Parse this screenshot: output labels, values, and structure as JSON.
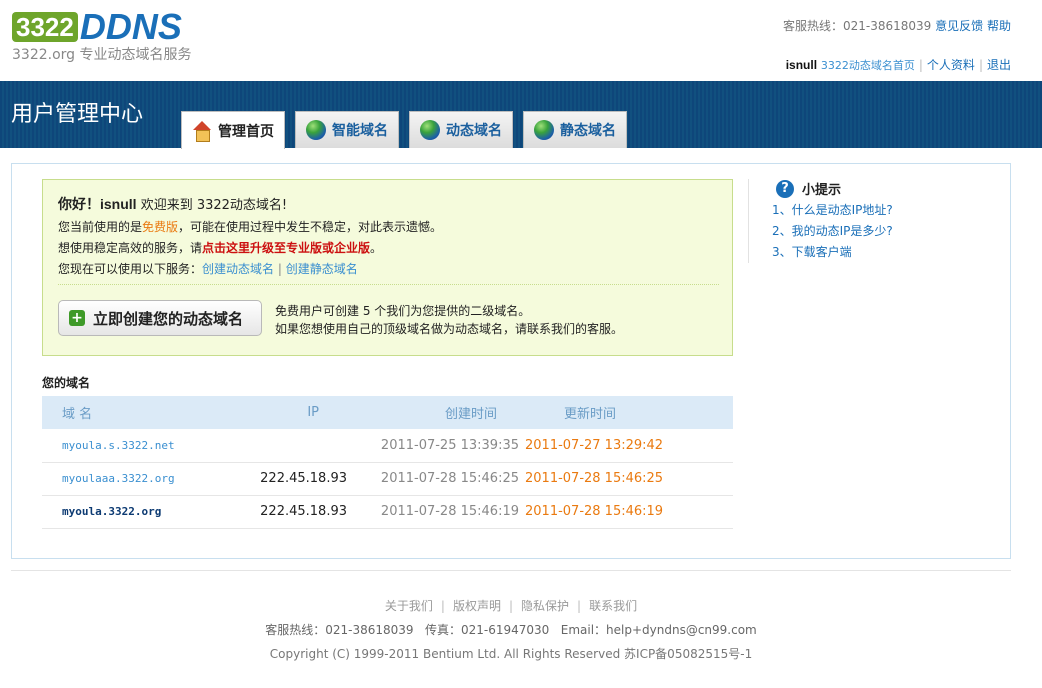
{
  "logo": {
    "num": "3322",
    "ddns": "DDNS",
    "subtitle": "3322.org 专业动态域名服务"
  },
  "top": {
    "hotline": "客服热线：021-38618039",
    "feedback": "意见反馈",
    "help": "帮助"
  },
  "user": {
    "name": "isnull",
    "home": "3322动态域名首页",
    "profile": "个人资料",
    "logout": "退出"
  },
  "nav": {
    "title": "用户管理中心",
    "tabs": [
      {
        "label": "管理首页",
        "active": true,
        "icon": "house-icon"
      },
      {
        "label": "智能域名",
        "active": false,
        "icon": "globe-icon"
      },
      {
        "label": "动态域名",
        "active": false,
        "icon": "globe-icon"
      },
      {
        "label": "静态域名",
        "active": false,
        "icon": "globe-icon"
      }
    ]
  },
  "welcome": {
    "hello": "你好！",
    "username": "isnull",
    "hello_rest": "欢迎来到 3322动态域名!",
    "line2_pre": "您当前使用的是",
    "line2_free": "免费版",
    "line2_post": "，可能在使用过程中发生不稳定，对此表示遗憾。",
    "line3_pre": "想使用稳定高效的服务，请",
    "line3_link": "点击这里升级至专业版或企业版",
    "line3_post": "。",
    "line4_pre": "您现在可以使用以下服务：",
    "link_dynamic": "创建动态域名",
    "link_static": "创建静态域名",
    "create_button": "立即创建您的动态域名",
    "note1": "免费用户可创建 5 个我们为您提供的二级域名。",
    "note2": "如果您想使用自己的顶级域名做为动态域名，请联系我们的客服。"
  },
  "tips": {
    "title": "小提示",
    "items": [
      "1、什么是动态IP地址?",
      "2、我的动态IP是多少?",
      "3、下载客户端"
    ]
  },
  "domains": {
    "title": "您的域名",
    "headers": [
      "域 名",
      "IP",
      "创建时间",
      "更新时间"
    ],
    "rows": [
      {
        "domain": "myoula.s.3322.net",
        "ip": "",
        "created": "2011-07-25 13:39:35",
        "updated": "2011-07-27 13:29:42"
      },
      {
        "domain": "myoulaaa.3322.org",
        "ip": "222.45.18.93",
        "created": "2011-07-28 15:46:25",
        "updated": "2011-07-28 15:46:25"
      },
      {
        "domain": "myoula.3322.org",
        "ip": "222.45.18.93",
        "created": "2011-07-28 15:46:19",
        "updated": "2011-07-28 15:46:19"
      }
    ]
  },
  "footer": {
    "links": [
      "关于我们",
      "版权声明",
      "隐私保护",
      "联系我们"
    ],
    "contact": "客服热线：021-38618039   传真：021-61947030   Email：help+dyndns@cn99.com",
    "copyright": "Copyright (C) 1999-2011 Bentium Ltd. All Rights Reserved 苏ICP备05082515号-1"
  }
}
